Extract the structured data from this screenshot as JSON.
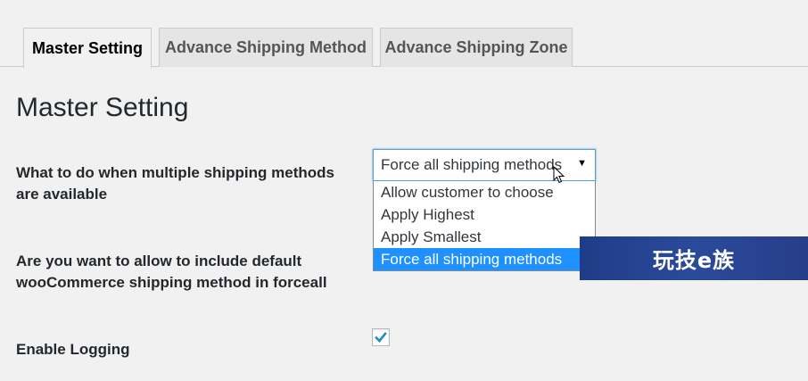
{
  "tabs": [
    {
      "label": "Master Setting",
      "active": true
    },
    {
      "label": "Advance Shipping Method",
      "active": false
    },
    {
      "label": "Advance Shipping Zone",
      "active": false
    }
  ],
  "page_title": "Master Setting",
  "settings": {
    "multiple_methods": {
      "label": "What to do when multiple shipping methods are available",
      "selected_value": "Force all shipping methods",
      "options": [
        {
          "label": "Allow customer to choose",
          "highlighted": false
        },
        {
          "label": "Apply Highest",
          "highlighted": false
        },
        {
          "label": "Apply Smallest",
          "highlighted": false
        },
        {
          "label": "Force all shipping methods",
          "highlighted": true
        }
      ]
    },
    "include_default": {
      "label": "Are you want to allow to include default wooCommerce shipping method in forceall"
    },
    "enable_logging": {
      "label": "Enable Logging",
      "checked": true
    }
  },
  "watermark": {
    "text": "玩技e族"
  },
  "colors": {
    "accent": "#1e90ff",
    "checkmark": "#1e8cbe",
    "watermark_bg": "#22418f"
  },
  "icons": {
    "select_caret": "triangle-down",
    "cursor": "arrow-pointer",
    "checkbox": "checkmark"
  }
}
